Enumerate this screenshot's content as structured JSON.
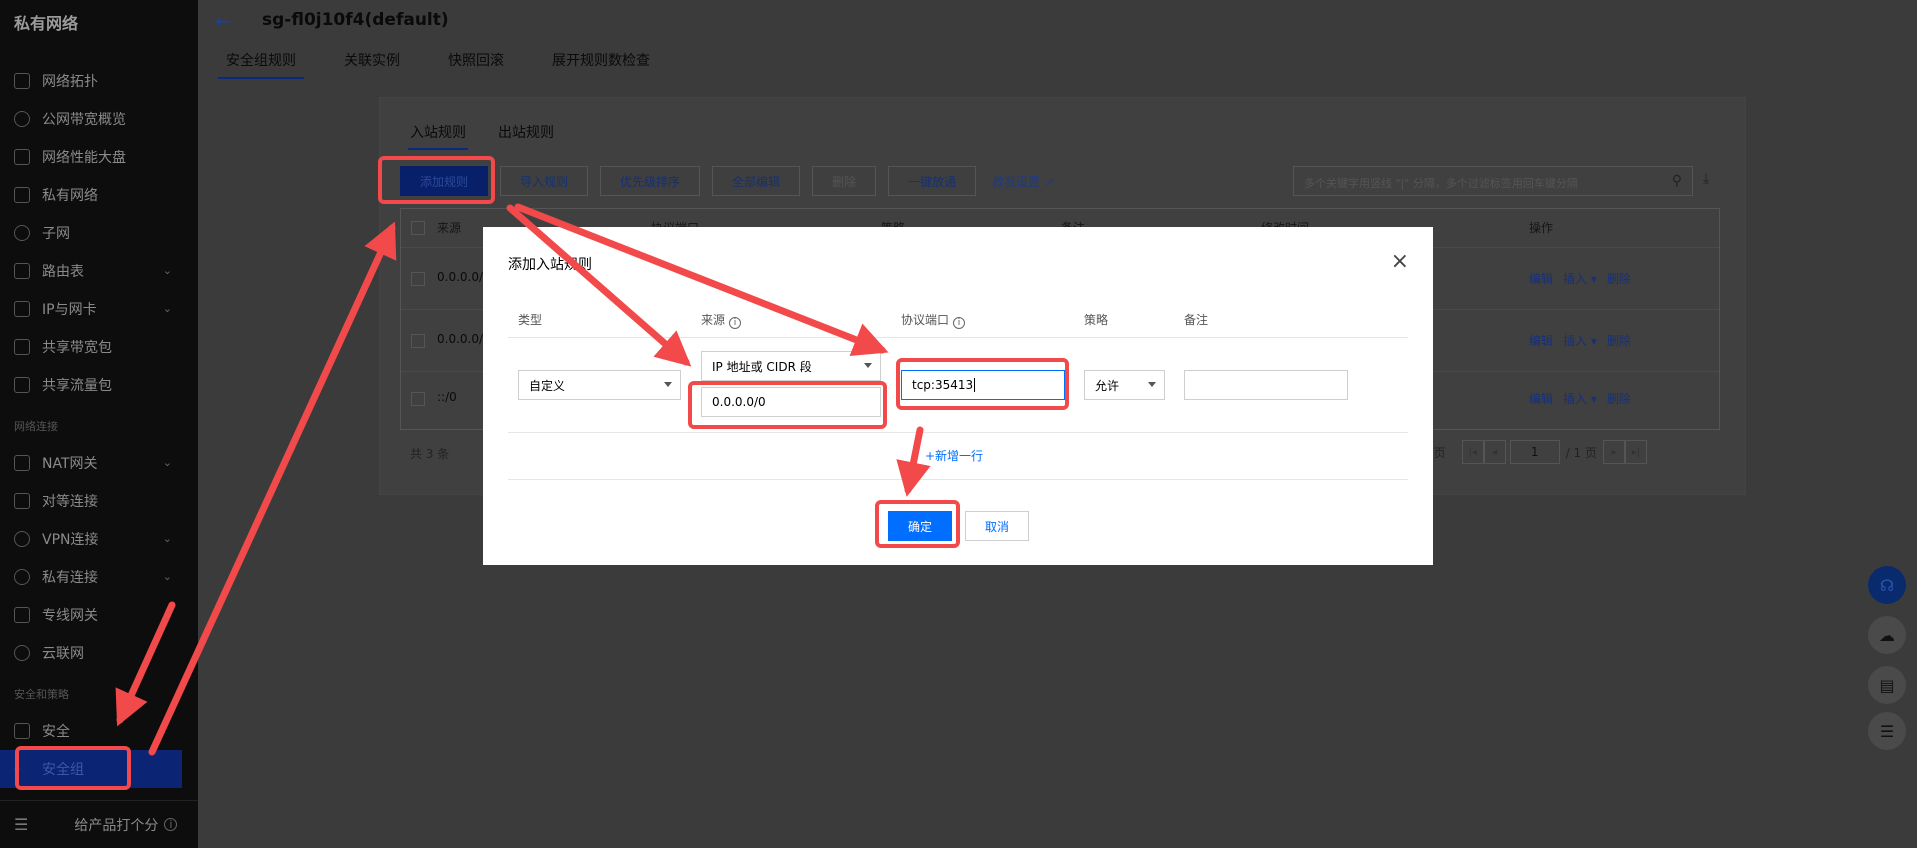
{
  "sidebar": {
    "title": "私有网络",
    "items": [
      {
        "label": "网络拓扑",
        "icon": "topology-icon"
      },
      {
        "label": "公网带宽概览",
        "icon": "bandwidth-icon"
      },
      {
        "label": "网络性能大盘",
        "icon": "dashboard-icon"
      },
      {
        "label": "私有网络",
        "icon": "vpc-icon"
      },
      {
        "label": "子网",
        "icon": "subnet-icon"
      },
      {
        "label": "路由表",
        "icon": "route-table-icon"
      },
      {
        "label": "IP与网卡",
        "icon": "ip-nic-icon"
      },
      {
        "label": "共享带宽包",
        "icon": "shared-bandwidth-icon"
      },
      {
        "label": "共享流量包",
        "icon": "shared-traffic-icon"
      }
    ],
    "section_network": "网络连接",
    "net_items": [
      {
        "label": "NAT网关",
        "icon": "nat-gateway-icon"
      },
      {
        "label": "对等连接",
        "icon": "peering-icon"
      },
      {
        "label": "VPN连接",
        "icon": "vpn-icon"
      },
      {
        "label": "私有连接",
        "icon": "private-link-icon"
      },
      {
        "label": "专线网关",
        "icon": "direct-connect-icon"
      },
      {
        "label": "云联网",
        "icon": "ccn-icon"
      }
    ],
    "section_security": "安全和策略",
    "sec_items": [
      {
        "label": "安全",
        "icon": "shield-icon"
      },
      {
        "label": "安全组",
        "icon": "security-group-icon"
      }
    ],
    "footer_label": "给产品打个分"
  },
  "header": {
    "title": "sg-fl0j10f4(default)",
    "tabs": [
      "安全组规则",
      "关联实例",
      "快照回滚",
      "展开规则数检查"
    ]
  },
  "panel": {
    "tabs": [
      "入站规则",
      "出站规则"
    ],
    "toolbar": {
      "add": "添加规则",
      "import": "导入规则",
      "sort": "优先级排序",
      "edit_all": "全部编辑",
      "delete": "删除",
      "one_click": "一键放通",
      "tutorial": "教我设置"
    },
    "search_placeholder": "多个关键字用竖线 \"|\" 分隔，多个过滤标签用回车键分隔",
    "table": {
      "headers": [
        "来源",
        "协议端口",
        "策略",
        "备注",
        "修改时间",
        "操作"
      ],
      "rows": [
        {
          "source": "0.0.0.0/0"
        },
        {
          "source": "0.0.0.0/0"
        },
        {
          "source": "::/0"
        }
      ],
      "ops": [
        "编辑",
        "插入 ▾",
        "删除"
      ]
    },
    "pager": {
      "total": "共 3 条",
      "per_page": "条 / 页",
      "page": "1",
      "pages": "/ 1 页"
    }
  },
  "modal": {
    "title": "添加入站规则",
    "columns": {
      "type": "类型",
      "source": "来源",
      "port": "协议端口",
      "policy": "策略",
      "note": "备注"
    },
    "type_value": "自定义",
    "source_type": "IP 地址或 CIDR 段",
    "source_value": "0.0.0.0/0",
    "port_value": "tcp:35413",
    "policy_value": "允许",
    "note_value": "",
    "add_row": "+新增一行",
    "ok": "确定",
    "cancel": "取消"
  },
  "colors": {
    "primary": "#006eff",
    "annotation": "#f24a4a"
  },
  "float_tools": [
    "headset-icon",
    "cloud-icon",
    "book-icon",
    "list-icon"
  ]
}
